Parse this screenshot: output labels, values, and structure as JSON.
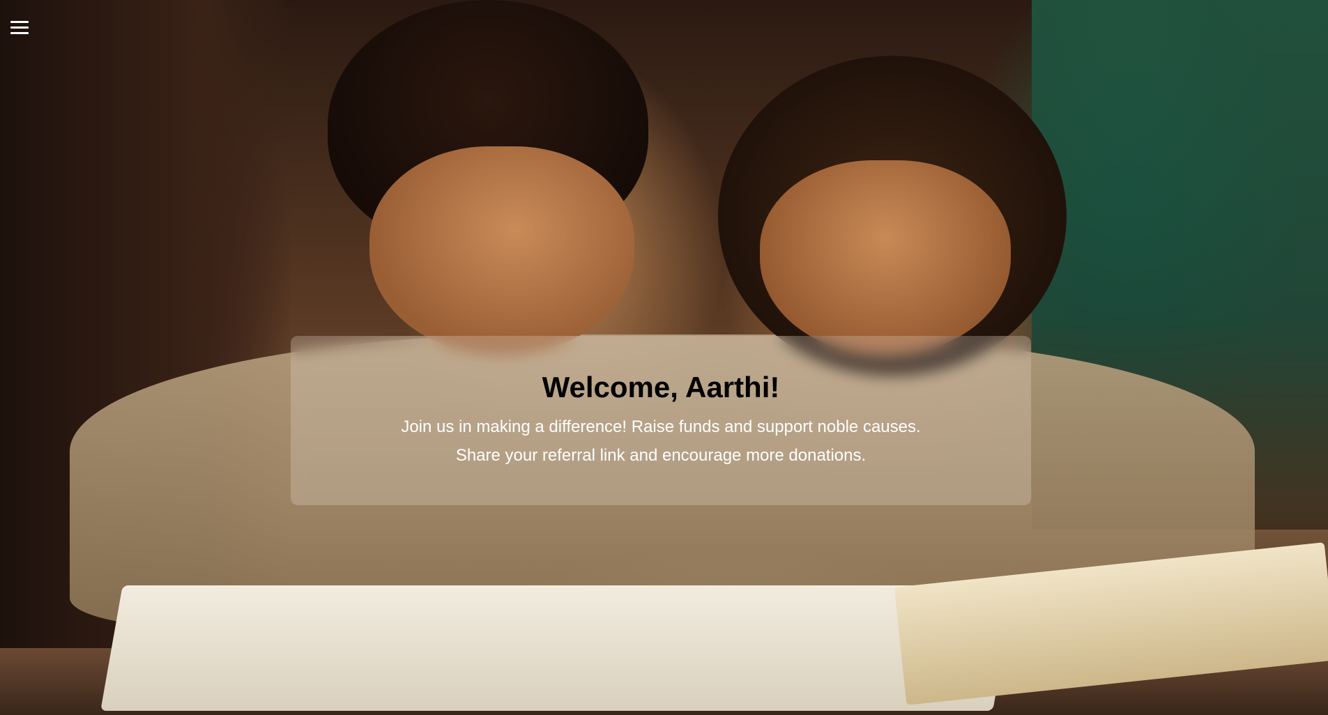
{
  "menu": {
    "icon": "hamburger-menu-icon"
  },
  "hero": {
    "background_image": "children-reading-photo"
  },
  "welcome": {
    "title": "Welcome, Aarthi!",
    "line1": "Join us in making a difference! Raise funds and support noble causes.",
    "line2": "Share your referral link and encourage more donations."
  },
  "colors": {
    "title": "#000000",
    "body_text": "#ffffff",
    "menu_icon": "#ffffff"
  }
}
